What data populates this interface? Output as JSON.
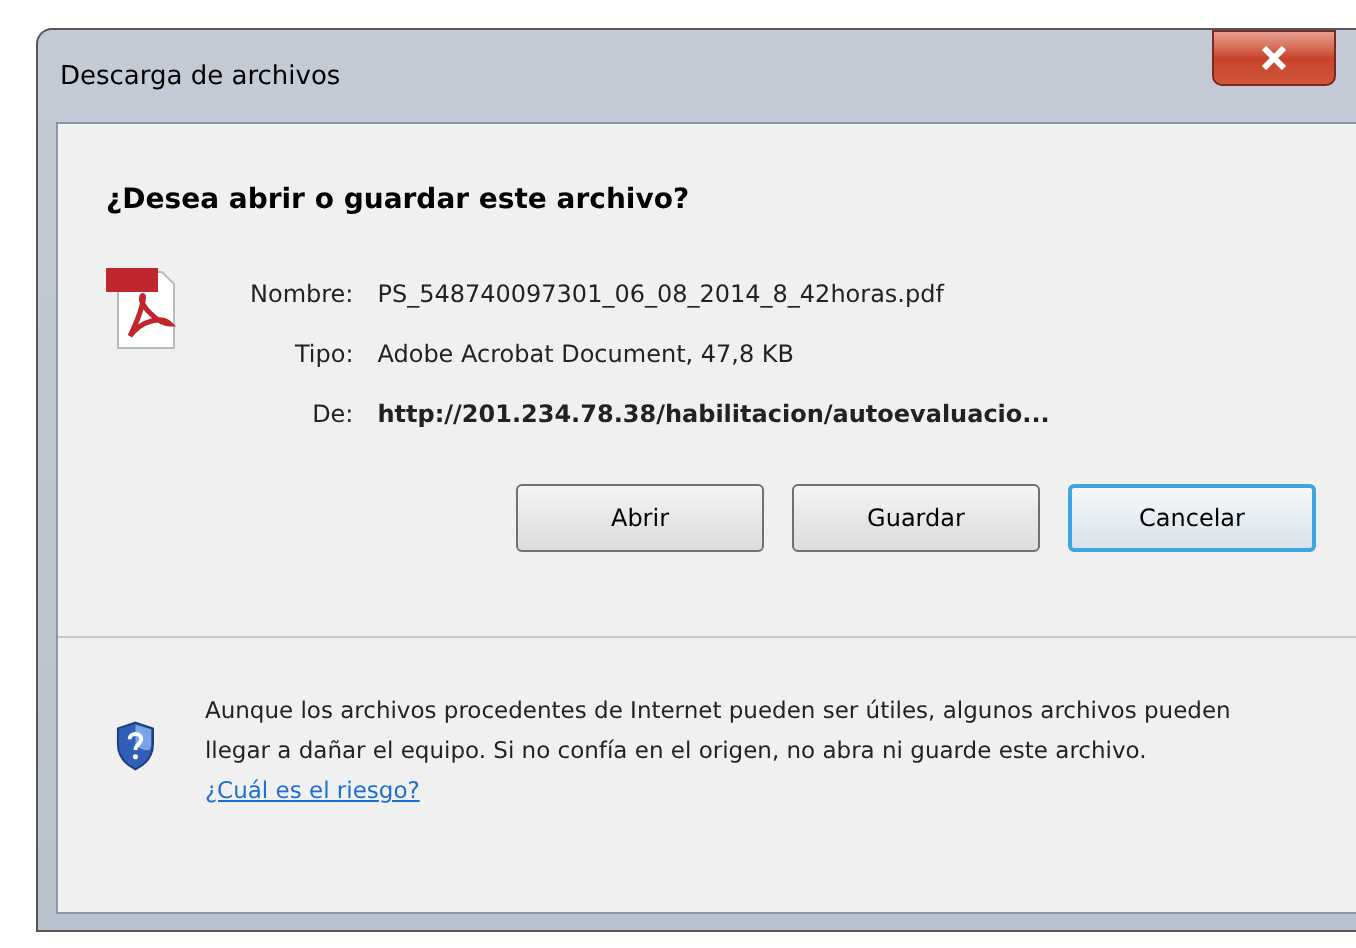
{
  "window": {
    "title": "Descarga de archivos"
  },
  "question": "¿Desea abrir o guardar este archivo?",
  "file_info": [
    {
      "label": "Nombre:",
      "value": "PS_548740097301_06_08_2014_8_42horas.pdf",
      "bold": false
    },
    {
      "label": "Tipo:",
      "value": "Adobe Acrobat Document, 47,8 KB",
      "bold": false
    },
    {
      "label": "De:",
      "value": "http://201.234.78.38/habilitacion/autoevaluacio...",
      "bold": true
    }
  ],
  "buttons": [
    {
      "label": "Abrir",
      "focused": false
    },
    {
      "label": "Guardar",
      "focused": false
    },
    {
      "label": "Cancelar",
      "focused": true
    }
  ],
  "warning": {
    "text": "Aunque los archivos procedentes de Internet pueden ser útiles, algunos archivos pueden llegar a dañar el equipo. Si no confía en el origen, no abra ni guarde este archivo.",
    "link": "¿Cuál es el riesgo?"
  }
}
